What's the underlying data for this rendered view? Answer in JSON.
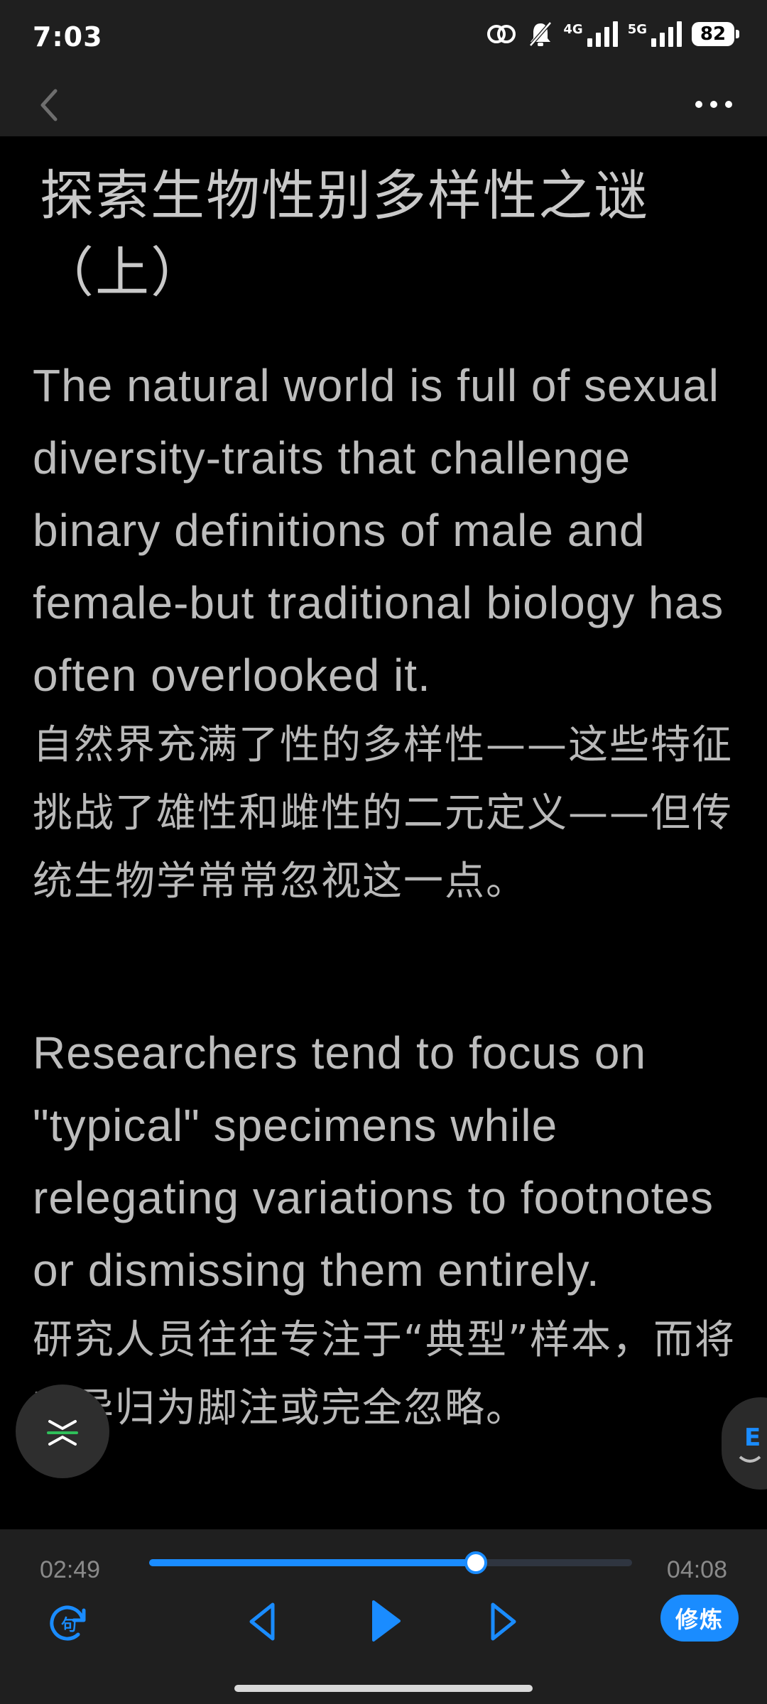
{
  "status_bar": {
    "time": "7:03",
    "network_4g": "4G",
    "network_5g": "5G",
    "battery": "82"
  },
  "article": {
    "title": "探索生物性别多样性之谜（上）",
    "paragraphs": [
      {
        "en": "The natural world is full of sexual diversity-traits that challenge binary definitions of male and female-but traditional biology has often overlooked it.",
        "zh": "自然界充满了性的多样性——这些特征挑战了雄性和雌性的二元定义——但传统生物学常常忽视这一点。"
      },
      {
        "en": "Researchers tend to focus on \"typical\" specimens while relegating variations to footnotes or dismissing them entirely.",
        "zh": "研究人员往往专注于“典型”样本，而将变异归为脚注或完全忽略。"
      }
    ]
  },
  "player": {
    "current_time": "02:49",
    "total_time": "04:08",
    "progress": 0.677,
    "practice_label": "修炼"
  },
  "colors": {
    "accent": "#1a8cff",
    "background": "#000000",
    "bar": "#1f1f1f",
    "text": "#bdbdbd"
  },
  "icons": {
    "back": "chevron-left-icon",
    "more": "more-horizontal-icon",
    "loop": "sentence-loop-icon",
    "prev": "triangle-left-icon",
    "play": "play-icon",
    "next": "triangle-right-icon",
    "float_left": "collapse-toggle-icon",
    "float_right": "translate-icon"
  }
}
